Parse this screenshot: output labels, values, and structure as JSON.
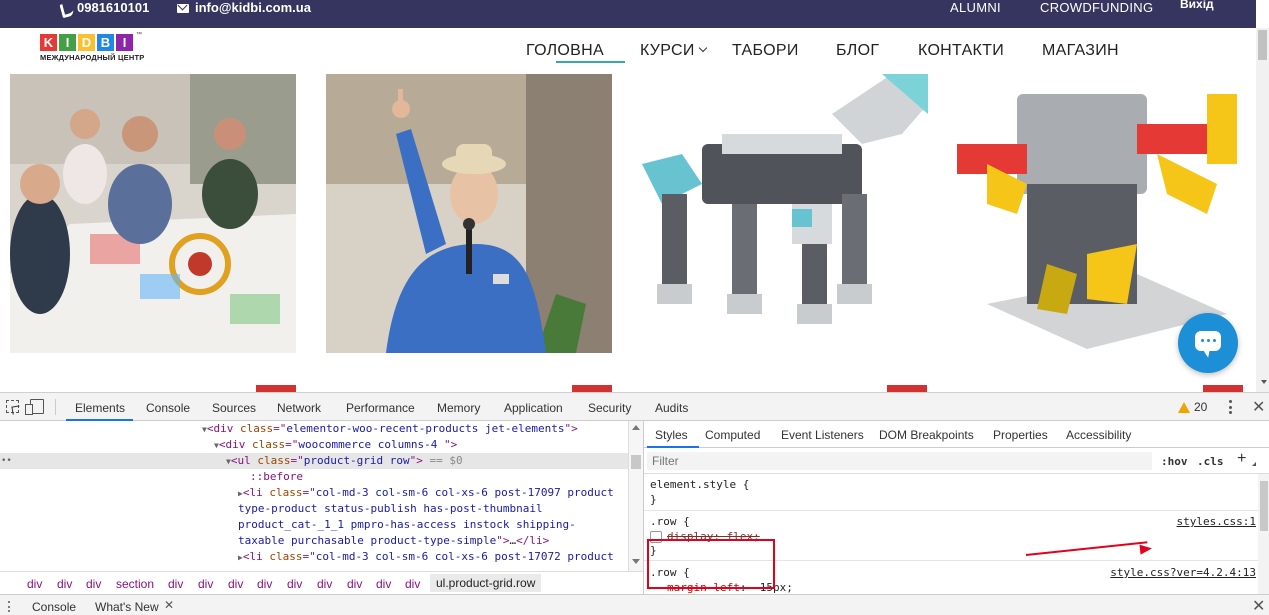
{
  "site": {
    "topbar": {
      "phone": "0981610101",
      "email": "info@kidbi.com.ua",
      "links": [
        "ALUMNI",
        "CROWDFUNDING"
      ],
      "exit": "Вихід"
    },
    "logo": {
      "letters": [
        "K",
        "I",
        "D",
        "B",
        "I"
      ],
      "letter_colors": [
        "#e53935",
        "#43a047",
        "#fbc02d",
        "#1e88e5",
        "#8e24aa"
      ],
      "subtitle": "МЕЖДУНАРОДНЫЙ ЦЕНТР",
      "tm": "™"
    },
    "nav": [
      "ГОЛОВНА",
      "КУРСИ",
      "ТАБОРИ",
      "БЛОГ",
      "КОНТАКТИ",
      "МАГАЗИН"
    ],
    "nav_active": "ГОЛОВНА",
    "accent_color": "#35355f",
    "chat_icon": "chat-bubble-icon"
  },
  "devtools": {
    "tabs": [
      "Elements",
      "Console",
      "Sources",
      "Network",
      "Performance",
      "Memory",
      "Application",
      "Security",
      "Audits"
    ],
    "active_tab": "Elements",
    "warnings": "20",
    "elements": {
      "line1": {
        "open": "<div ",
        "attr": "class",
        "eq": "=\"",
        "val": "elementor-woo-recent-products jet-elements",
        "close": "\">"
      },
      "line2": {
        "open": "<div ",
        "attr": "class",
        "eq": "=\"",
        "val": "woocommerce columns-4 ",
        "close": "\">"
      },
      "line3": {
        "open": "<ul ",
        "attr": "class",
        "eq": "=\"",
        "val": "product-grid row",
        "close": "\">",
        "suffix": " == $0"
      },
      "line4": "::before",
      "line5": {
        "open": "<li ",
        "attr": "class",
        "eq": "=\"",
        "val": "col-md-3 col-sm-6 col-xs-6 post-17097 product"
      },
      "line6": "type-product status-publish has-post-thumbnail",
      "line7": "product_cat-_1_1 pmpro-has-access  instock shipping-",
      "line8": {
        "text": "taxable purchasable product-type-simple",
        "close": "\">",
        "ellipsis": "…",
        "end": "</li>"
      },
      "line9": {
        "open": "<li ",
        "attr": "class",
        "eq": "=\"",
        "val": "col-md-3 col-sm-6 col-xs-6 post-17072 product"
      }
    },
    "breadcrumb": [
      "div",
      "div",
      "div",
      "section",
      "div",
      "div",
      "div",
      "div",
      "div",
      "div",
      "div",
      "div",
      "div",
      "div",
      "ul.product-grid.row"
    ],
    "styles_tabs": [
      "Styles",
      "Computed",
      "Event Listeners",
      "DOM Breakpoints",
      "Properties",
      "Accessibility"
    ],
    "active_styles_tab": "Styles",
    "filter_placeholder": "Filter",
    "hov": ":hov",
    "cls": ".cls",
    "plus": "+",
    "rules": {
      "element_style_open": "element.style {",
      "element_style_close": "}",
      "row1_selector": ".row {",
      "row1_prop": "display",
      "row1_value": ": flex;",
      "row1_close": "}",
      "row1_source": "styles.css:1",
      "row2_selector": ".row {",
      "row2_prop": "margin-left",
      "row2_value": ": -15px;",
      "row2_source": "style.css?ver=4.2.4:13"
    },
    "drawer_tabs": [
      "Console",
      "What's New"
    ],
    "annotation_color": "#e3001b"
  }
}
